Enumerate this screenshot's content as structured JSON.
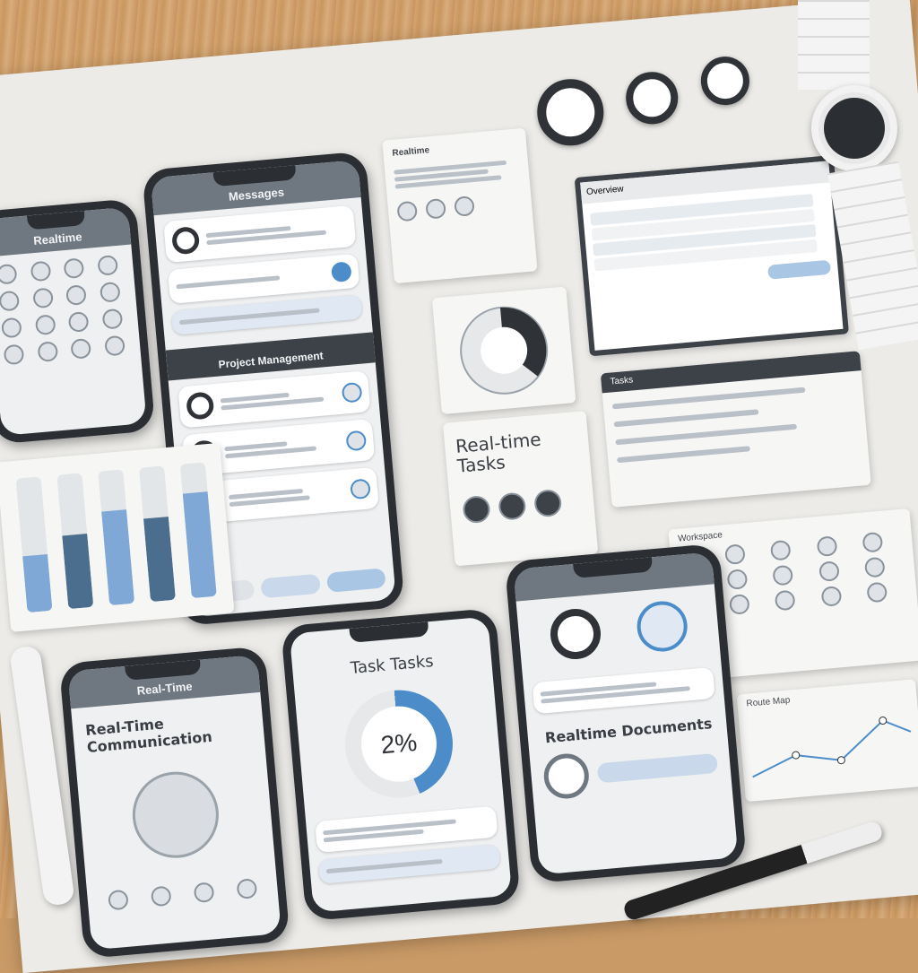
{
  "phones": {
    "p1_title": "Realtime",
    "p2_title": "Messages",
    "p2_section": "Project Management",
    "p5_title": "Real-Time",
    "p5_heading": "Real-Time Communication",
    "p6_title": "Task Tasks",
    "p6_percent": "2%",
    "p7_heading": "Realtime Documents"
  },
  "panels": {
    "top_title": "Realtime",
    "table_title": "Overview",
    "tasks_small": "Tasks",
    "tasks_big": "Real-time Tasks",
    "grid_title": "Workspace",
    "map_title": "Route Map"
  },
  "colors": {
    "accent": "#4b8cc9",
    "dark": "#2f3236",
    "header": "#6f7780",
    "paper": "#ecebe8"
  },
  "bars": [
    0.42,
    0.55,
    0.7,
    0.62,
    0.78
  ]
}
